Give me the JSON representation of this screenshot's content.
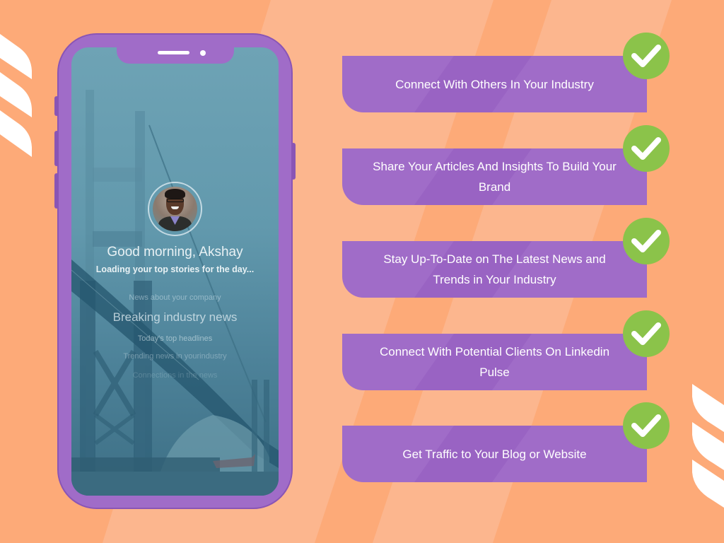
{
  "colors": {
    "background": "#fdaa78",
    "background_band": "#fcb68e",
    "phone": "#a06cc8",
    "phone_edge": "#8a55b5",
    "card": "#a06cc8",
    "check": "#8bc34a",
    "decor": "#ffffff"
  },
  "phone": {
    "profile": {
      "icon": "user-avatar-photo"
    },
    "greeting": "Good morning, Akshay",
    "loading_text": "Loading your top stories for the day...",
    "news_ticker": [
      "News about your company",
      "Breaking industry news",
      "Today's top headlines",
      "Trending news in yourindustry",
      "Connections in the news"
    ]
  },
  "features": [
    {
      "text": "Connect With Others In Your Industry",
      "icon": "check-icon"
    },
    {
      "text": "Share Your Articles And Insights To Build Your Brand",
      "icon": "check-icon"
    },
    {
      "text": "Stay Up-To-Date on The Latest News and Trends in Your Industry",
      "icon": "check-icon"
    },
    {
      "text": "Connect With Potential Clients On Linkedin Pulse",
      "icon": "check-icon"
    },
    {
      "text": "Get Traffic to Your Blog or Website",
      "icon": "check-icon"
    }
  ]
}
